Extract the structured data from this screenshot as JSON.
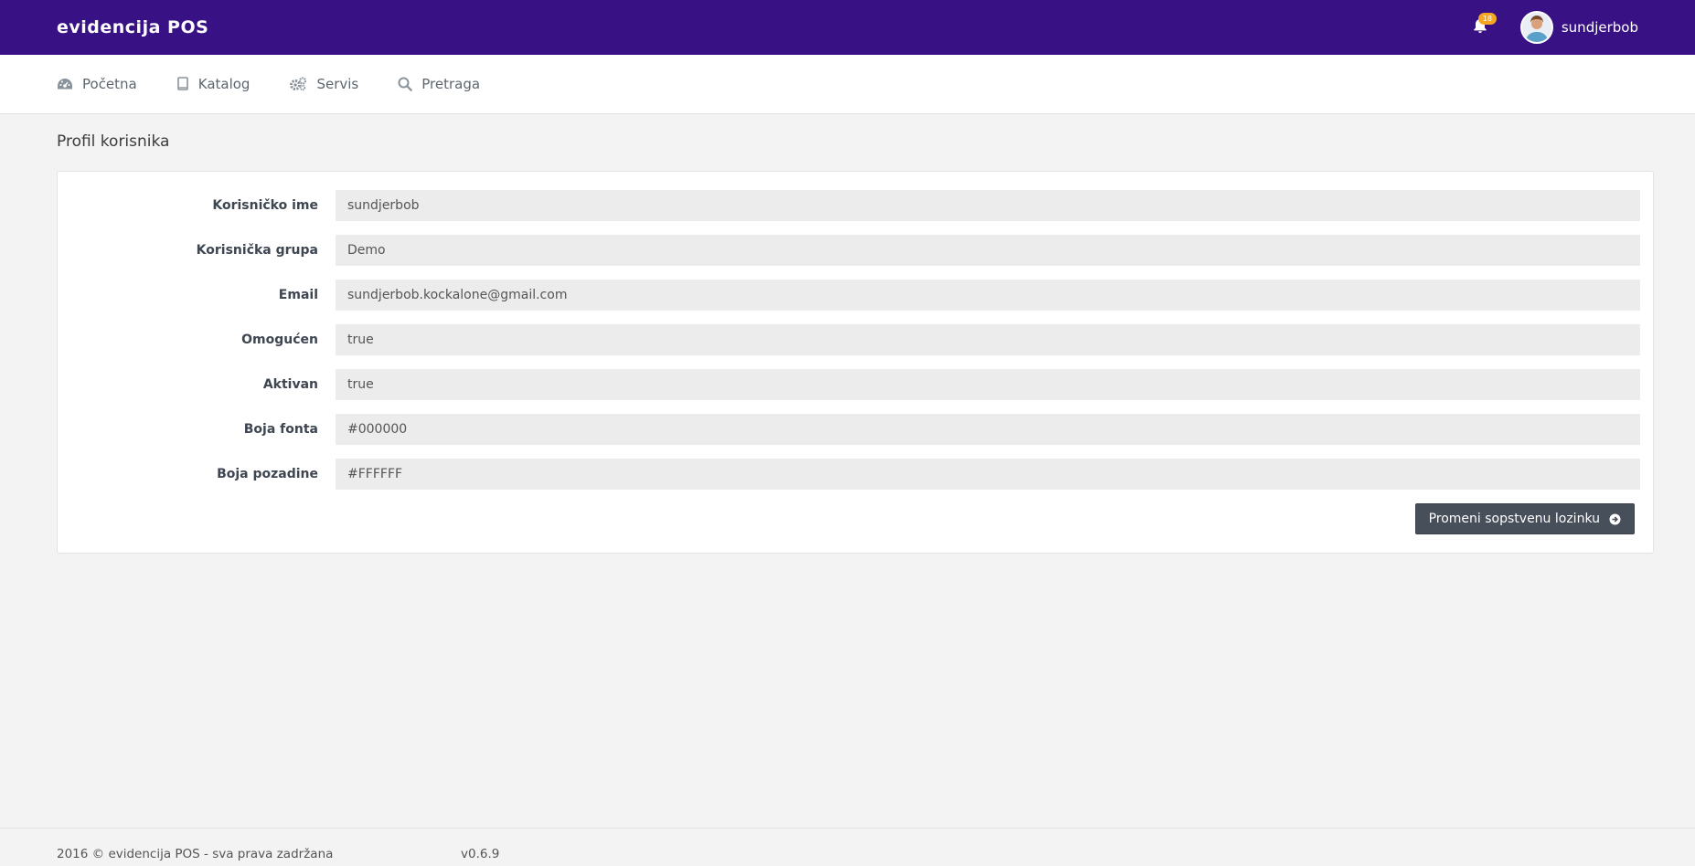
{
  "header": {
    "brand": "evidencija POS",
    "notification_count": "18",
    "username": "sundjerbob",
    "accent_color": "#381184",
    "badge_color": "#f5a623"
  },
  "nav": {
    "items": [
      {
        "label": "Početna",
        "icon": "dashboard-icon"
      },
      {
        "label": "Katalog",
        "icon": "book-icon"
      },
      {
        "label": "Servis",
        "icon": "gears-icon"
      },
      {
        "label": "Pretraga",
        "icon": "search-icon"
      }
    ]
  },
  "page": {
    "title": "Profil korisnika"
  },
  "profile": {
    "fields": [
      {
        "label": "Korisničko ime",
        "value": "sundjerbob"
      },
      {
        "label": "Korisnička grupa",
        "value": "Demo"
      },
      {
        "label": "Email",
        "value": "sundjerbob.kockalone@gmail.com"
      },
      {
        "label": "Omogućen",
        "value": "true"
      },
      {
        "label": "Aktivan",
        "value": "true"
      },
      {
        "label": "Boja fonta",
        "value": "#000000"
      },
      {
        "label": "Boja pozadine",
        "value": "#FFFFFF"
      }
    ],
    "change_password_label": "Promeni sopstvenu lozinku"
  },
  "footer": {
    "copyright": "2016 © evidencija POS - sva prava zadržana",
    "version": "v0.6.9"
  }
}
